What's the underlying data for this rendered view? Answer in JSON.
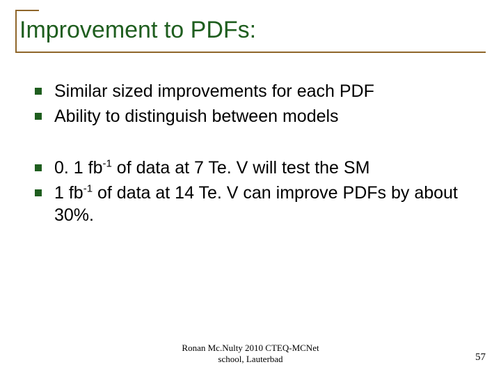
{
  "title": "Improvement to PDFs:",
  "group1": {
    "item1": "Similar sized improvements for each PDF",
    "item2": "Ability to distinguish between models"
  },
  "group2": {
    "item1_pre": "0. 1 fb",
    "item1_sup": "-1",
    "item1_post": " of data at 7 Te. V will test the SM",
    "item2_pre": "1 fb",
    "item2_sup": "-1",
    "item2_post": " of data at 14 Te. V can improve PDFs  by about 30%."
  },
  "footer": {
    "line1": "Ronan Mc.Nulty  2010 CTEQ-MCNet",
    "line2": "school, Lauterbad"
  },
  "page": "57"
}
